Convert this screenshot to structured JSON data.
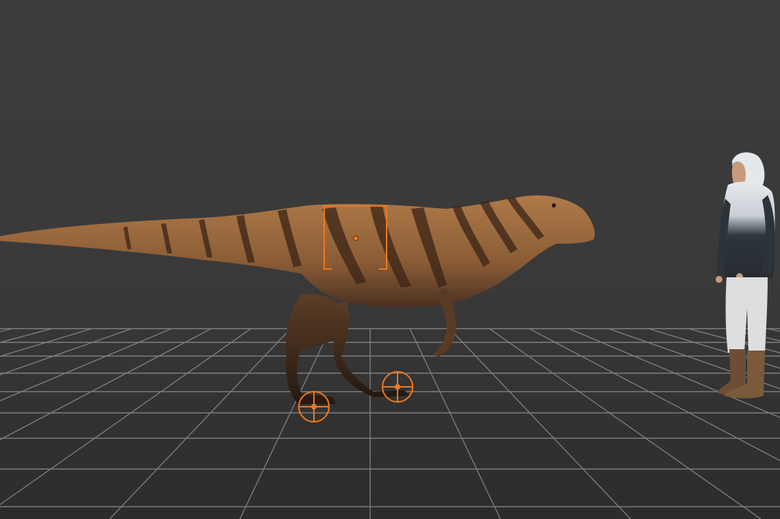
{
  "scene": {
    "subjects": [
      {
        "name": "dinosaur-model"
      },
      {
        "name": "human-reference-model"
      }
    ],
    "controls": [
      {
        "name": "body-control-frame"
      },
      {
        "name": "left-foot-ik-control"
      },
      {
        "name": "right-foot-ik-control"
      }
    ]
  },
  "colors": {
    "background_top": "#3b3b3b",
    "background_bottom": "#2e2e2e",
    "grid_line": "#8a8a8a",
    "control_orange": "#f07a1e",
    "dino_skin": "#9a6a3e",
    "dino_stripe": "#3a2416",
    "hoodie_dark": "#2a3138",
    "hoodie_light": "#d8dde2",
    "pants": "#dcdcdc",
    "boots": "#6b4e33"
  }
}
